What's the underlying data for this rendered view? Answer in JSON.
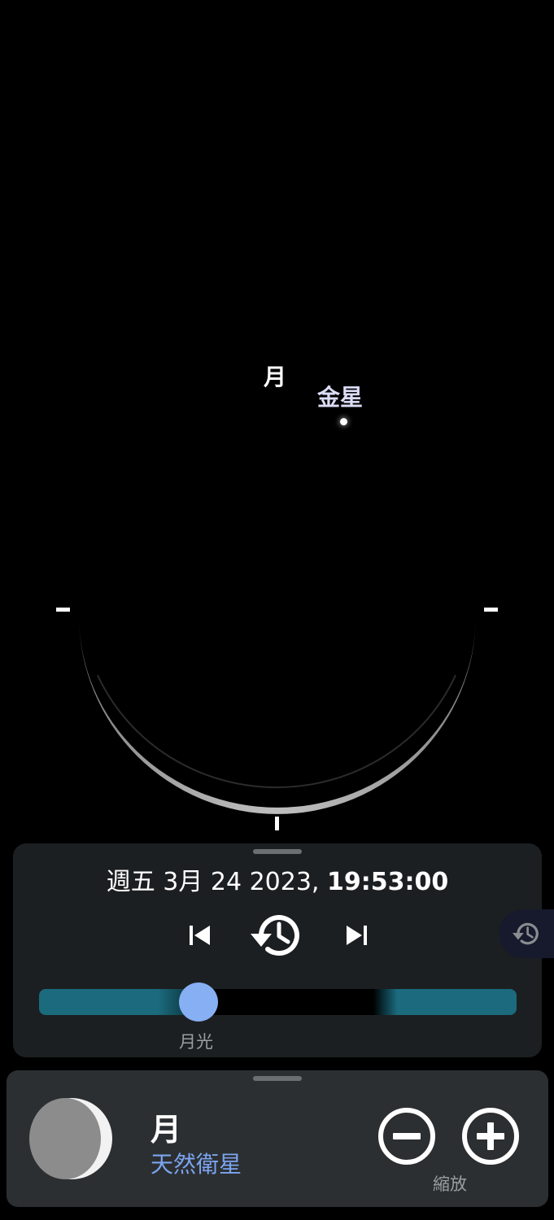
{
  "sky": {
    "moon_label": "月",
    "venus_label": "金星"
  },
  "time_panel": {
    "date": "週五 3月 24 2023, ",
    "time": "19:53:00",
    "slider": {
      "caption": "月光",
      "position": 0.33
    }
  },
  "object_panel": {
    "name": "月",
    "type": "天然衛星",
    "zoom_label": "縮放"
  },
  "icons": {
    "prev": "skip-previous-icon",
    "reset": "history-icon",
    "next": "skip-next-icon",
    "history_tab": "history-icon",
    "zoom_out": "minus-circle-icon",
    "zoom_in": "plus-circle-icon"
  }
}
